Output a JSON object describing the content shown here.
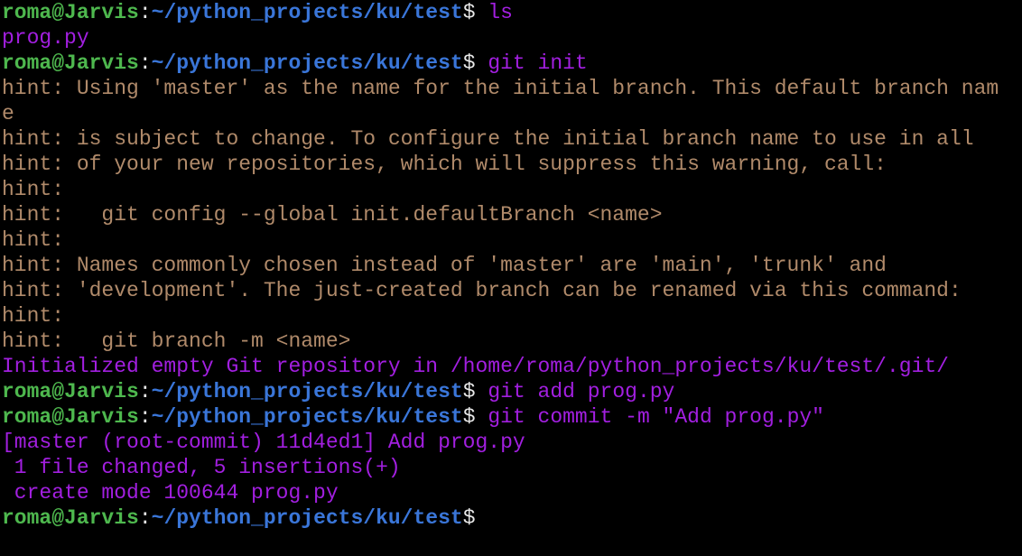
{
  "colors": {
    "background": "#000000",
    "prompt_user": "#4eb84e",
    "prompt_path": "#3a76d9",
    "prompt_separator": "#e8e8e8",
    "command": "#a21fe0",
    "hint": "#b08a6a"
  },
  "prompt": {
    "user_host": "roma@Jarvis",
    "separator": ":",
    "path": "~/python_projects/ku/test",
    "symbol": "$ "
  },
  "lines": [
    {
      "kind": "prompt",
      "command": "ls"
    },
    {
      "kind": "output",
      "text": "prog.py"
    },
    {
      "kind": "prompt",
      "command": "git init"
    },
    {
      "kind": "hint",
      "text": "hint: Using 'master' as the name for the initial branch. This default branch nam"
    },
    {
      "kind": "hint",
      "text": "e"
    },
    {
      "kind": "hint",
      "text": "hint: is subject to change. To configure the initial branch name to use in all"
    },
    {
      "kind": "hint",
      "text": "hint: of your new repositories, which will suppress this warning, call:"
    },
    {
      "kind": "hint",
      "text": "hint:"
    },
    {
      "kind": "hint",
      "text": "hint:   git config --global init.defaultBranch <name>"
    },
    {
      "kind": "hint",
      "text": "hint:"
    },
    {
      "kind": "hint",
      "text": "hint: Names commonly chosen instead of 'master' are 'main', 'trunk' and"
    },
    {
      "kind": "hint",
      "text": "hint: 'development'. The just-created branch can be renamed via this command:"
    },
    {
      "kind": "hint",
      "text": "hint:"
    },
    {
      "kind": "hint",
      "text": "hint:   git branch -m <name>"
    },
    {
      "kind": "output",
      "text": "Initialized empty Git repository in /home/roma/python_projects/ku/test/.git/"
    },
    {
      "kind": "prompt",
      "command": "git add prog.py"
    },
    {
      "kind": "prompt",
      "command": "git commit -m \"Add prog.py\""
    },
    {
      "kind": "output",
      "text": "[master (root-commit) 11d4ed1] Add prog.py"
    },
    {
      "kind": "output",
      "text": " 1 file changed, 5 insertions(+)"
    },
    {
      "kind": "output",
      "text": " create mode 100644 prog.py"
    },
    {
      "kind": "prompt",
      "command": ""
    }
  ]
}
